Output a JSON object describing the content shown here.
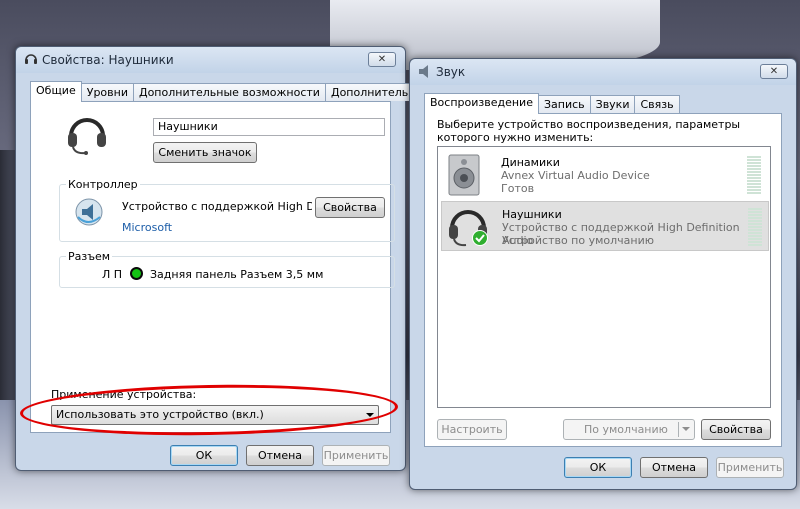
{
  "props_window": {
    "title": "Свойства: Наушники",
    "close": "✕",
    "tabs": [
      "Общие",
      "Уровни",
      "Дополнительные возможности",
      "Дополнительно"
    ],
    "device_name": "Наушники",
    "change_icon": "Сменить значок",
    "controller": {
      "label": "Контроллер",
      "name": "Устройство с поддержкой High Definition Audio",
      "vendor": "Microsoft",
      "properties": "Свойства"
    },
    "jack": {
      "label": "Разъем",
      "channels": "Л П",
      "description": "Задняя панель Разъем 3,5 мм"
    },
    "usage": {
      "label": "Применение устройства:",
      "value": "Использовать это устройство (вкл.)"
    },
    "buttons": {
      "ok": "ОК",
      "cancel": "Отмена",
      "apply": "Применить"
    }
  },
  "sound_window": {
    "title": "Звук",
    "close": "✕",
    "tabs": [
      "Воспроизведение",
      "Запись",
      "Звуки",
      "Связь"
    ],
    "instruction": "Выберите устройство воспроизведения, параметры которого нужно изменить:",
    "devices": [
      {
        "name": "Динамики",
        "description": "Avnex Virtual Audio Device",
        "status": "Готов"
      },
      {
        "name": "Наушники",
        "description": "Устройство с поддержкой High Definition Audio",
        "status": "Устройство по умолчанию"
      }
    ],
    "configure": "Настроить",
    "set_default": "По умолчанию",
    "properties": "Свойства",
    "buttons": {
      "ok": "ОК",
      "cancel": "Отмена",
      "apply": "Применить"
    }
  },
  "colors": {
    "annotation": "#e00000",
    "default_check": "#2fae2f",
    "jack_dot": "#13c313"
  }
}
